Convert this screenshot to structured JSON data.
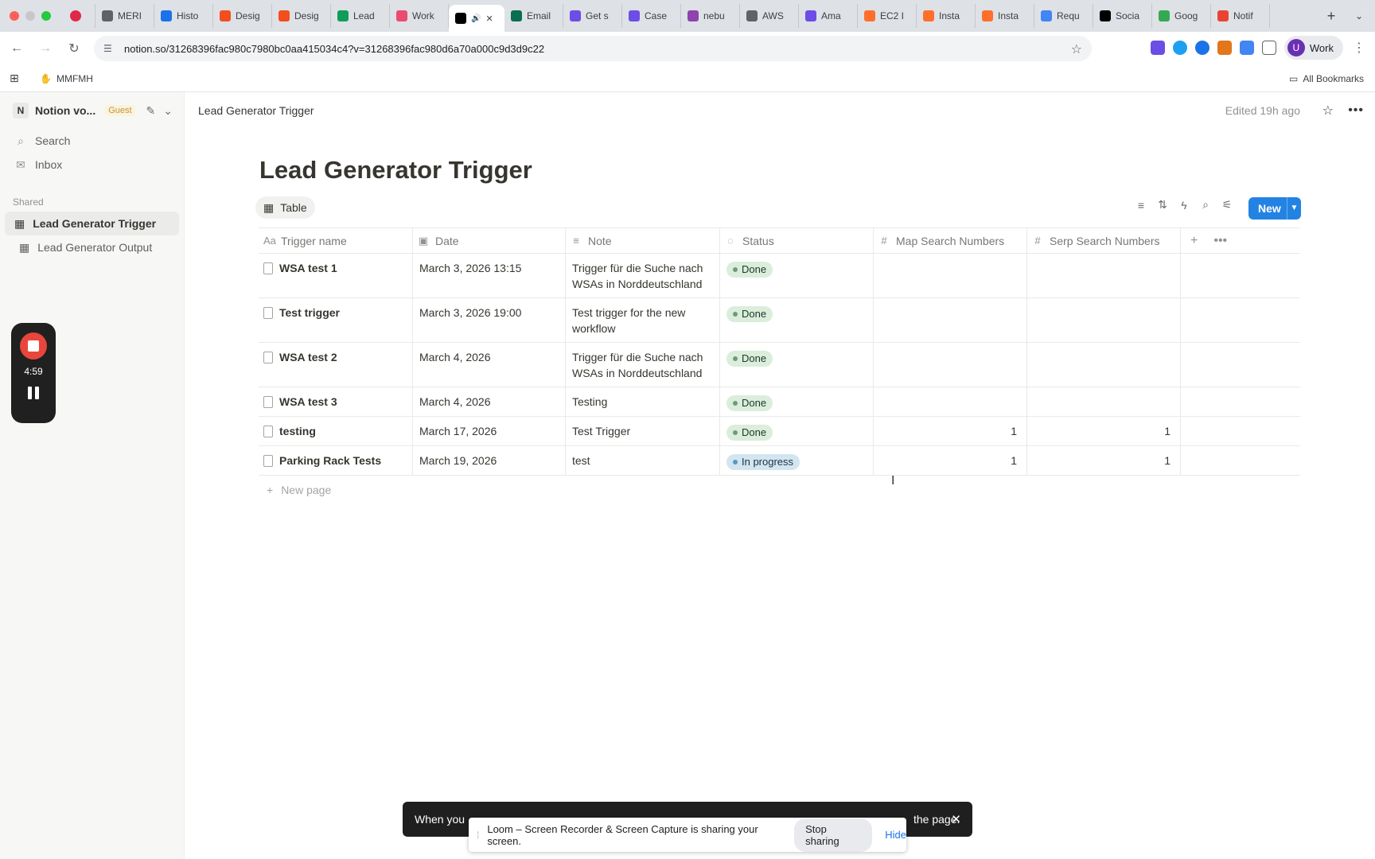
{
  "browser": {
    "tabs": [
      {
        "label": "",
        "color": "#e0284a"
      },
      {
        "label": "MERI",
        "color": "#5f6368"
      },
      {
        "label": "Histo",
        "color": "#1a73e8"
      },
      {
        "label": "Desig",
        "color": "#f24e1e"
      },
      {
        "label": "Desig",
        "color": "#f24e1e"
      },
      {
        "label": "Lead",
        "color": "#0f9d58"
      },
      {
        "label": "Work",
        "color": "#ea4b71"
      },
      {
        "label": "",
        "color": "#000000"
      },
      {
        "label": "Email",
        "color": "#0b6e4f"
      },
      {
        "label": "Get s",
        "color": "#6c4de6"
      },
      {
        "label": "Case",
        "color": "#6c4de6"
      },
      {
        "label": "nebu",
        "color": "#8e44ad"
      },
      {
        "label": "AWS",
        "color": "#5f6368"
      },
      {
        "label": "Ama",
        "color": "#6c4de6"
      },
      {
        "label": "EC2 I",
        "color": "#ff6f2c"
      },
      {
        "label": "Insta",
        "color": "#ff6f2c"
      },
      {
        "label": "Insta",
        "color": "#ff6f2c"
      },
      {
        "label": "Requ",
        "color": "#4285f4"
      },
      {
        "label": "Socia",
        "color": "#000000"
      },
      {
        "label": "Goog",
        "color": "#34a853"
      },
      {
        "label": "Notif",
        "color": "#ea4335"
      }
    ],
    "url": "notion.so/31268396fac980c7980bc0aa415034c4?v=31268396fac980d6a70a000c9d3d9c22",
    "profile_initial": "U",
    "profile_label": "Work",
    "bookmark": "MMFMH",
    "all_bookmarks": "All Bookmarks"
  },
  "sidebar": {
    "workspace_initial": "N",
    "workspace_name": "Notion vo...",
    "guest_badge": "Guest",
    "search": "Search",
    "inbox": "Inbox",
    "section": "Shared",
    "pages": [
      {
        "label": "Lead Generator Trigger",
        "active": true
      },
      {
        "label": "Lead Generator Output",
        "active": false
      }
    ]
  },
  "loom": {
    "timer": "4:59"
  },
  "page": {
    "breadcrumb": "Lead Generator Trigger",
    "edited": "Edited 19h ago",
    "title": "Lead Generator Trigger",
    "view_tab": "Table",
    "new_button": "New",
    "add_page": "New page"
  },
  "table": {
    "columns": [
      {
        "label": "Trigger name",
        "icon": "Aa"
      },
      {
        "label": "Date",
        "icon": "calendar-icon"
      },
      {
        "label": "Note",
        "icon": "text-lines-icon"
      },
      {
        "label": "Status",
        "icon": "status-icon"
      },
      {
        "label": "Map Search Numbers",
        "icon": "#"
      },
      {
        "label": "Serp Search Numbers",
        "icon": "#"
      }
    ],
    "rows": [
      {
        "name": "WSA test 1",
        "date": "March 3, 2026 13:15",
        "note": "Trigger für die Suche nach WSAs in Norddeutschland",
        "status": "Done",
        "map": "",
        "serp": ""
      },
      {
        "name": "Test trigger",
        "date": "March 3, 2026 19:00",
        "note": "Test trigger for the new workflow",
        "status": "Done",
        "map": "",
        "serp": ""
      },
      {
        "name": "WSA test 2",
        "date": "March 4, 2026",
        "note": "Trigger für die Suche nach WSAs in Norddeutschland",
        "status": "Done",
        "map": "",
        "serp": ""
      },
      {
        "name": "WSA test 3",
        "date": "March 4, 2026",
        "note": "Testing",
        "status": "Done",
        "map": "",
        "serp": ""
      },
      {
        "name": "testing",
        "date": "March 17, 2026",
        "note": "Test Trigger",
        "status": "Done",
        "map": "1",
        "serp": "1"
      },
      {
        "name": "Parking Rack Tests",
        "date": "March 19, 2026",
        "note": "test",
        "status": "In progress",
        "map": "1",
        "serp": "1"
      }
    ]
  },
  "share": {
    "toast_start": "When you",
    "toast_end": "the page.",
    "bar_text": "Loom – Screen Recorder & Screen Capture is sharing your screen.",
    "stop": "Stop sharing",
    "hide": "Hide"
  },
  "colors": {
    "accent": "#2383e2",
    "done_bg": "#dbeddb",
    "progress_bg": "#d3e5ef",
    "loom_red": "#e8453c"
  }
}
